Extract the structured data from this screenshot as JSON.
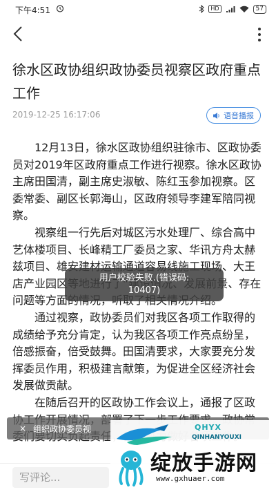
{
  "status_bar": {
    "time": "下午4:51",
    "hd": "HD",
    "battery": "57"
  },
  "article": {
    "title": "徐水区政协组织政协委员视察区政府重点工作",
    "datetime": "2019-12-25 16:17:06",
    "tts_label": "语音播报",
    "paragraphs": [
      "12月13日，徐水区政协组织驻徐市、区政协委员对2019年区政府重点工作进行视察。徐水区政协主席田国清，副主席史淑敏、陈红玉参加视察。区委常委、副区长郭海山，区政府领导李建军陪同视察。",
      "视察组一行先后对城区污水处理厂、综合高中艺体楼项目、长峰精工厂委员之家、华讯方舟太赫兹项目、雄安建材运输通道容易线施工现场、大王店产业园区等地进行了“建设情况、发展前景、存在问题等方面的情况，听取了相关情况介绍。",
      "通过视察，政协委员们对我区各项工作取得的成绩给予充分肯定，认为我区各项工作亮点纷呈，倍感振奋，倍受鼓舞。田国清要求，大家要充分发挥委员作用，积极建言献策，为促进全区经济社会发展做贡献。",
      "在随后召开的区政协工作会议上，通报了区政协工作开展情况，部署了下一步工作要求，政协常委们要切实负起责任，齐心协力做好各项工作。"
    ]
  },
  "toast": {
    "line1": "用户校验失败.(错误码:",
    "line2": "10407)"
  },
  "banner": {
    "close": "×",
    "text": "组织政协委员视"
  },
  "comment": {
    "placeholder": "写评论..."
  },
  "watermark": {
    "brand": "QHYX",
    "brand_sub": "QINHANYOUXI",
    "name": "绽放手游网",
    "url": "www.gxhuaer.com"
  },
  "colors": {
    "accent": "#3a7bd5",
    "meta_gray": "#999999",
    "text": "#222222"
  }
}
